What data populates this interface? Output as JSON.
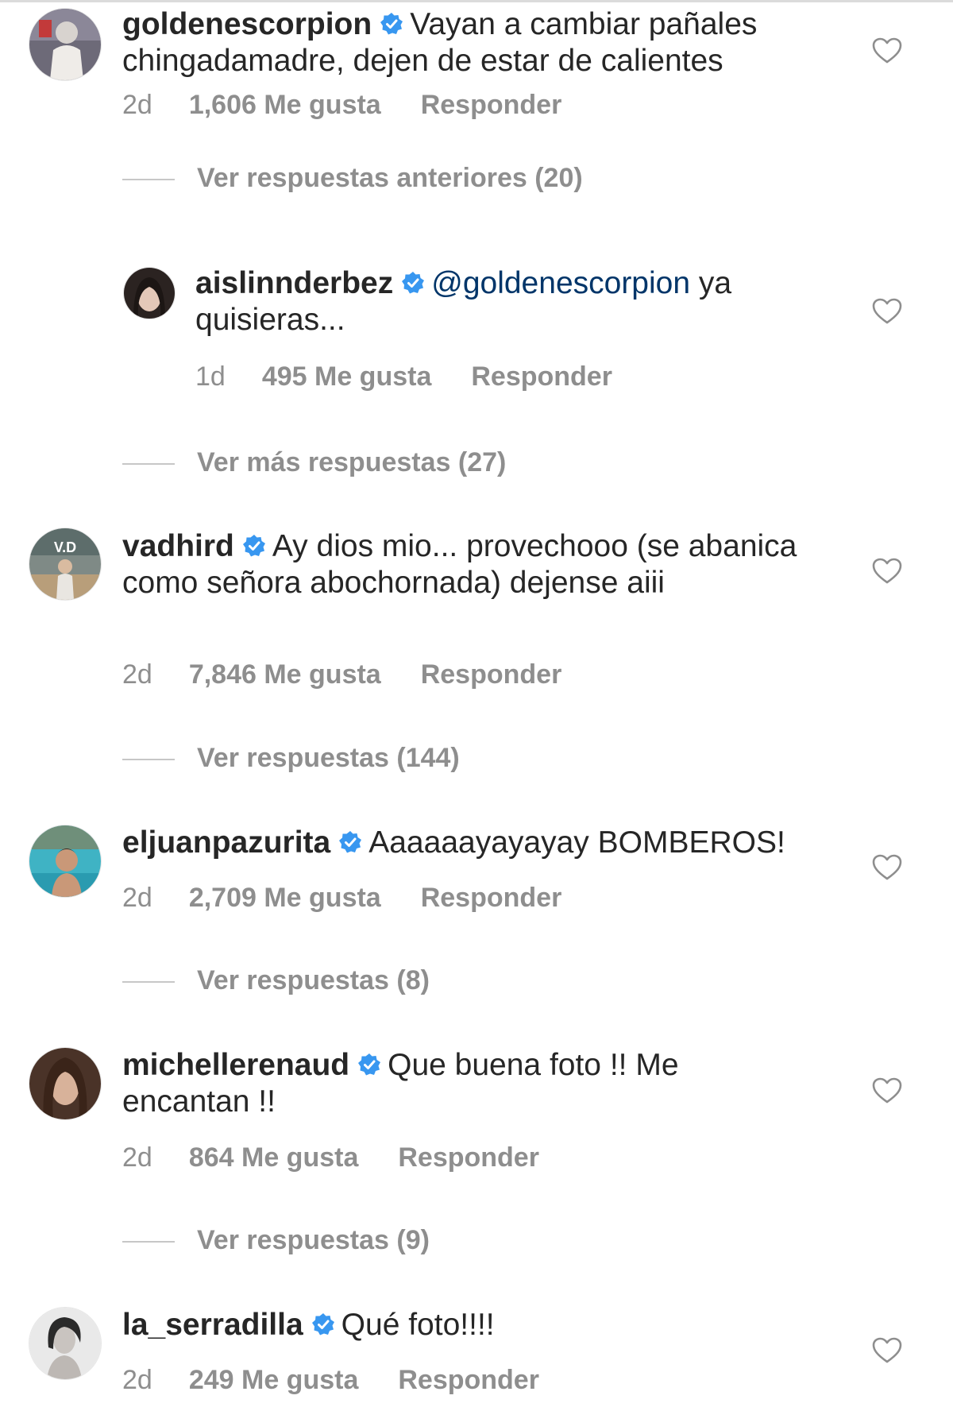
{
  "comments": [
    {
      "username": "goldenescorpion",
      "mention": "",
      "text": "Vayan a cambiar pañales chingadamadre, dejen de estar de calientes",
      "time": "2d",
      "likes": "1,606 Me gusta",
      "respond": "Responder",
      "view_replies": "Ver respuestas anteriores (20)"
    },
    {
      "username": "aislinnderbez",
      "mention": "@goldenescorpion",
      "text": " ya quisieras...",
      "time": "1d",
      "likes": "495 Me gusta",
      "respond": "Responder",
      "view_replies": "Ver más respuestas (27)"
    },
    {
      "username": "vadhird",
      "mention": "",
      "text": "Ay dios mio... provechooo (se abanica como señora abochornada) dejense aiii",
      "time": "2d",
      "likes": "7,846 Me gusta",
      "respond": "Responder",
      "view_replies": "Ver respuestas (144)"
    },
    {
      "username": "eljuanpazurita",
      "mention": "",
      "text": "Aaaaaayayayay BOMBEROS!",
      "time": "2d",
      "likes": "2,709 Me gusta",
      "respond": "Responder",
      "view_replies": "Ver respuestas (8)"
    },
    {
      "username": "michellerenaud",
      "mention": "",
      "text": "Que buena foto !! Me encantan !!",
      "time": "2d",
      "likes": "864 Me gusta",
      "respond": "Responder",
      "view_replies": "Ver respuestas (9)"
    },
    {
      "username": "la_serradilla",
      "mention": "",
      "text": "Qué foto!!!!",
      "time": "2d",
      "likes": "249 Me gusta",
      "respond": "Responder"
    }
  ],
  "avatar_texts": {
    "vadhird": "V.D"
  },
  "colors": {
    "verified": "#3897f0",
    "meta": "#8e8e8e",
    "mention": "#003569",
    "text": "#262626"
  },
  "icons": {
    "verified": "verified-badge-icon",
    "like": "heart-outline-icon"
  }
}
